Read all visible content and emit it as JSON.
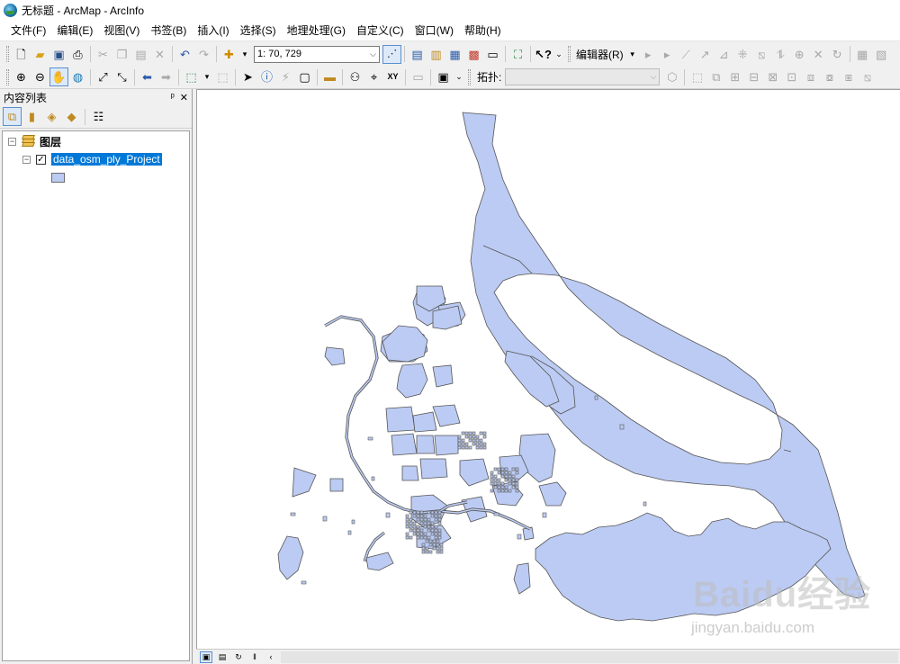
{
  "window": {
    "title": "无标题 - ArcMap - ArcInfo"
  },
  "menu": {
    "items": [
      {
        "label": "文件(F)"
      },
      {
        "label": "编辑(E)"
      },
      {
        "label": "视图(V)"
      },
      {
        "label": "书签(B)"
      },
      {
        "label": "插入(I)"
      },
      {
        "label": "选择(S)"
      },
      {
        "label": "地理处理(G)"
      },
      {
        "label": "自定义(C)"
      },
      {
        "label": "窗口(W)"
      },
      {
        "label": "帮助(H)"
      }
    ]
  },
  "toolbar_standard": {
    "scale_value": "1: 70, 729",
    "editor_label": "编辑器(R)",
    "icons": [
      "new-document-icon",
      "open-folder-icon",
      "save-icon",
      "print-icon",
      "cut-icon",
      "copy-icon",
      "paste-icon",
      "delete-icon",
      "undo-icon",
      "redo-icon",
      "add-data-icon",
      "editor-toolbar-icon",
      "toc-window-icon",
      "catalog-window-icon",
      "search-window-icon",
      "arctoolbox-icon",
      "python-window-icon",
      "model-builder-icon",
      "whats-this-icon"
    ]
  },
  "toolbar_tools": {
    "snapping_label": "拓扑:"
  },
  "toc": {
    "title": "内容列表",
    "pin_glyph": "ᵖ",
    "close_glyph": "✕",
    "root_label": "图层",
    "layer_name": "data_osm_ply_Project",
    "layer_checked": true,
    "symbol_color": "#bccbf3"
  },
  "map": {
    "fill_color": "#bccbf3",
    "stroke_color": "#555555"
  },
  "watermark": {
    "main": "Bai",
    "paw": "du",
    "suffix": "经验",
    "sub": "jingyan.baidu.com"
  }
}
